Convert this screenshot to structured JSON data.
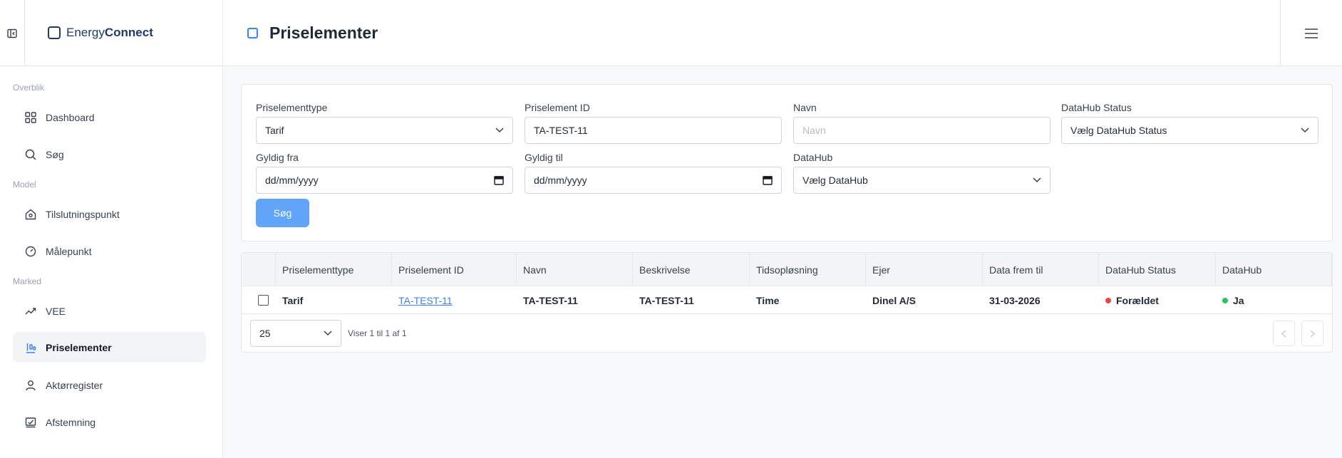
{
  "brand": {
    "part1": "Energy",
    "part2": "Connect"
  },
  "sidebar": {
    "sections": [
      {
        "label": "Overblik"
      },
      {
        "label": "Model"
      },
      {
        "label": "Marked"
      }
    ],
    "items": [
      {
        "label": "Dashboard"
      },
      {
        "label": "Søg"
      },
      {
        "label": "Tilslutningspunkt"
      },
      {
        "label": "Målepunkt"
      },
      {
        "label": "VEE"
      },
      {
        "label": "Priselementer"
      },
      {
        "label": "Aktørregister"
      },
      {
        "label": "Afstemning"
      }
    ]
  },
  "header": {
    "title": "Priselementer"
  },
  "filters": {
    "type": {
      "label": "Priselementtype",
      "value": "Tarif"
    },
    "id": {
      "label": "Priselement ID",
      "value": "TA-TEST-11"
    },
    "name": {
      "label": "Navn",
      "placeholder": "Navn"
    },
    "dh_status": {
      "label": "DataHub Status",
      "value": "Vælg DataHub Status"
    },
    "valid_from": {
      "label": "Gyldig fra",
      "value": "dd/mm/yyyy"
    },
    "valid_to": {
      "label": "Gyldig til",
      "value": "dd/mm/yyyy"
    },
    "datahub": {
      "label": "DataHub",
      "value": "Vælg DataHub"
    },
    "search_label": "Søg"
  },
  "table": {
    "columns": [
      "Priselementtype",
      "Priselement ID",
      "Navn",
      "Beskrivelse",
      "Tidsopløsning",
      "Ejer",
      "Data frem til",
      "DataHub Status",
      "DataHub"
    ],
    "rows": [
      {
        "type": "Tarif",
        "id": "TA-TEST-11",
        "name": "TA-TEST-11",
        "description": "TA-TEST-11",
        "resolution": "Time",
        "owner": "Dinel A/S",
        "data_until": "31-03-2026",
        "dh_status": "Forældet",
        "datahub": "Ja"
      }
    ],
    "page_size": "25",
    "info": "Viser 1 til 1 af 1"
  },
  "colors": {
    "accent": "#3b82f6",
    "button": "#60a5fa",
    "status_red": "#ef4444",
    "status_green": "#22c55e"
  }
}
